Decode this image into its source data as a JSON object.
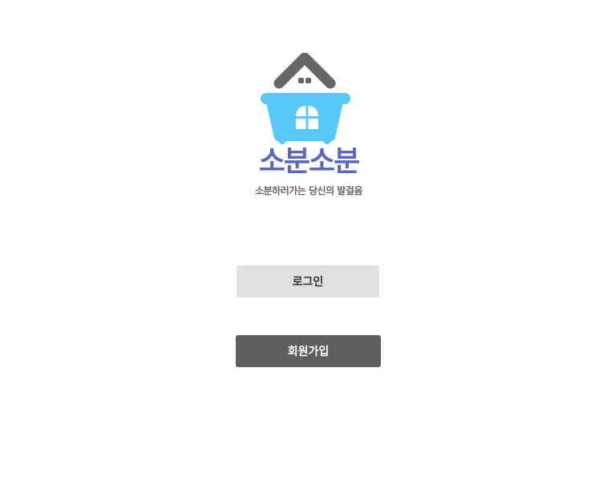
{
  "brand": {
    "name": "소분소분",
    "tagline": "소분하러가는 당신의 발걸음",
    "logo_icon": "house-basket-icon",
    "colors": {
      "basket": "#58c8f8",
      "roof": "#666666",
      "name": "#5b68c0"
    }
  },
  "actions": {
    "login_label": "로그인",
    "signup_label": "회원가입"
  }
}
